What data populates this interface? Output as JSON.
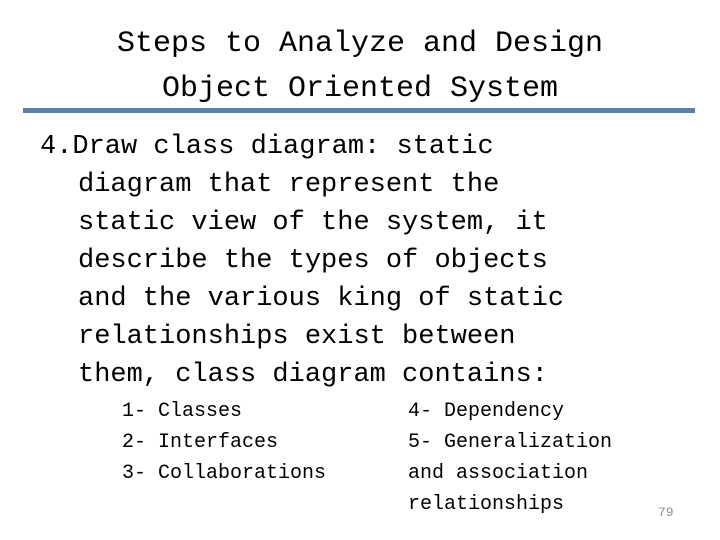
{
  "slide": {
    "title": {
      "line1": "Steps to Analyze and Design",
      "line2": "Object Oriented System"
    },
    "divider_color": "#5b80a8",
    "body": {
      "lines": [
        "4.Draw class diagram: static",
        "diagram that represent the",
        "static view of the system, it",
        "describe the types of objects",
        "and the various king of static",
        "relationships exist between",
        "them, class diagram contains:"
      ]
    },
    "sublist_left": [
      "1- Classes",
      "2- Interfaces",
      "3- Collaborations"
    ],
    "sublist_right": [
      "4- Dependency",
      "5- Generalization",
      "and association",
      "relationships"
    ],
    "page_number": "79"
  }
}
